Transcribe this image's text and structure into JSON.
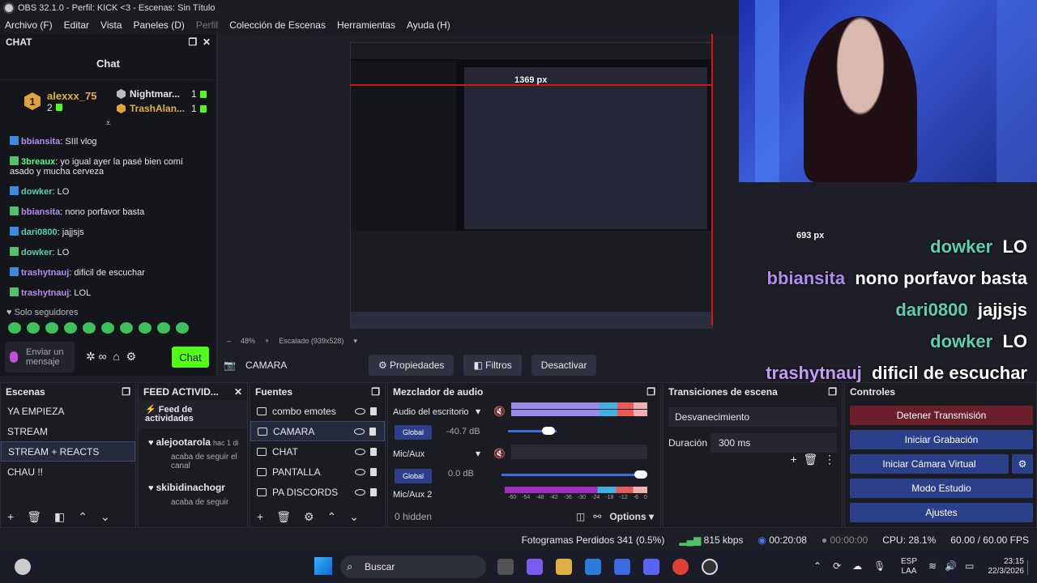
{
  "window": {
    "title": "OBS 32.1.0 - Perfil: KICK <3 - Escenas: Sin Título"
  },
  "menu": [
    "Archivo (F)",
    "Editar",
    "Vista",
    "Paneles (D)",
    "Perfil",
    "Colección de Escenas",
    "Herramientas",
    "Ayuda (H)"
  ],
  "chat": {
    "dock_title": "CHAT",
    "title": "Chat",
    "leaderboard": [
      {
        "rank": "1",
        "name": "alexxx_75",
        "count": "2"
      },
      {
        "name": "Nightmar...",
        "count": "1"
      },
      {
        "name": "TrashAlan...",
        "count": "1"
      }
    ],
    "messages": [
      {
        "user": "bbiansita",
        "text": "SIIl vlog",
        "color": "#b28cf0"
      },
      {
        "user": "3breaux",
        "text": "yo igual ayer la pasé bien comí asado y mucha cerveza",
        "color": "#53fc90"
      },
      {
        "user": "dowker",
        "text": "LO",
        "color": "#5ad0b0"
      },
      {
        "user": "bbiansita",
        "text": "nono porfavor basta",
        "color": "#b28cf0"
      },
      {
        "user": "dari0800",
        "text": "jajjsjs",
        "color": "#5ad0b0"
      },
      {
        "user": "dowker",
        "text": "LO",
        "color": "#5ad0b0"
      },
      {
        "user": "trashytnauj",
        "text": "dificil de escuchar",
        "color": "#b28cf0"
      },
      {
        "user": "trashytnauj",
        "text": "LOL",
        "color": "#b28cf0"
      }
    ],
    "followers_only": "Solo seguidores",
    "input_placeholder": "Enviar un mensaje",
    "send_label": "Chat"
  },
  "preview": {
    "width_label": "1369 px",
    "height_label": "693 px",
    "zoom": "48%",
    "scale": "Escalado (939x528)"
  },
  "overlay_chat": [
    {
      "user": "dowker",
      "text": "LO",
      "color": "#5ad0b0"
    },
    {
      "user": "bbiansita",
      "text": "nono porfavor basta",
      "color": "#b28cf0"
    },
    {
      "user": "dari0800",
      "text": "jajjsjs",
      "color": "#5ad0b0"
    },
    {
      "user": "dowker",
      "text": "LO",
      "color": "#5ad0b0"
    },
    {
      "user": "trashytnauj",
      "text": "dificil de escuchar",
      "color": "#c59cf5"
    },
    {
      "user": "trashytnauj",
      "text": "LOL",
      "color": "#c59cf5"
    }
  ],
  "sourcebar": {
    "name": "CAMARA",
    "props": "Propiedades",
    "filters": "Filtros",
    "deactivate": "Desactivar"
  },
  "scenes": {
    "title": "Escenas",
    "items": [
      "YA EMPIEZA",
      "STREAM",
      "STREAM + REACTS",
      "CHAU !!"
    ]
  },
  "feed": {
    "title": "FEED ACTIVID...",
    "header": "Feed de actividades",
    "items": [
      {
        "user": "alejootarola",
        "time": "hac 1 di",
        "text": "acaba de seguir el canal"
      },
      {
        "user": "skibidinachogr",
        "text": "acaba de seguir"
      }
    ]
  },
  "sources": {
    "title": "Fuentes",
    "items": [
      "combo emotes",
      "CAMARA",
      "CHAT",
      "PANTALLA",
      "PA DISCORDS"
    ]
  },
  "mixer": {
    "title": "Mezclador de audio",
    "ch1": "Audio del escritorio",
    "ch1_db": "-40.7 dB",
    "ch2": "Mic/Aux",
    "ch2_db": "0.0 dB",
    "ch3": "Mic/Aux 2",
    "global": "Global",
    "hidden": "0 hidden",
    "options": "Options",
    "scale": [
      "-60",
      "-54",
      "-48",
      "-42",
      "-36",
      "-30",
      "-24",
      "-18",
      "-12",
      "-6",
      "0"
    ]
  },
  "transitions": {
    "title": "Transiciones de escena",
    "type": "Desvanecimiento",
    "duration_label": "Duración",
    "duration": "300 ms"
  },
  "controls": {
    "title": "Controles",
    "buttons": [
      "Detener Transmisión",
      "Iniciar Grabación",
      "Iniciar Cámara Virtual",
      "Modo Estudio",
      "Ajustes"
    ]
  },
  "status": {
    "dropped": "Fotogramas Perdidos 341 (0.5%)",
    "kbps": "815 kbps",
    "live": "00:20:08",
    "rec": "00:00:00",
    "cpu": "CPU: 28.1%",
    "fps": "60.00 / 60.00 FPS"
  },
  "taskbar": {
    "search": "Buscar",
    "lang1": "ESP",
    "lang2": "LAA",
    "time": "23:15",
    "date": "22/3/2026"
  }
}
